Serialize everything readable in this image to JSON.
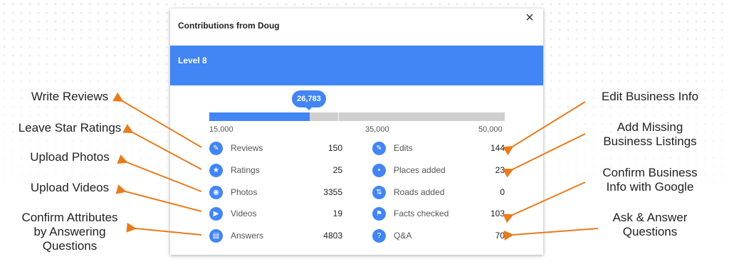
{
  "card": {
    "title": "Contributions from Doug",
    "close_icon": "×",
    "level": "Level 8",
    "points": "26,783",
    "progress_fraction": 0.3391,
    "ticks": [
      "15,000",
      "35,000",
      "50,000"
    ],
    "accent": "#4285f4"
  },
  "stats_left": [
    {
      "label": "Reviews",
      "value": "150",
      "icon": "review-icon",
      "glyph": "✎"
    },
    {
      "label": "Ratings",
      "value": "25",
      "icon": "star-icon",
      "glyph": "★"
    },
    {
      "label": "Photos",
      "value": "3355",
      "icon": "camera-icon",
      "glyph": "◉"
    },
    {
      "label": "Videos",
      "value": "19",
      "icon": "video-icon",
      "glyph": "▶"
    },
    {
      "label": "Answers",
      "value": "4803",
      "icon": "answers-icon",
      "glyph": "▤"
    }
  ],
  "stats_right": [
    {
      "label": "Edits",
      "value": "144",
      "icon": "edit-pin-icon",
      "glyph": "✎"
    },
    {
      "label": "Places added",
      "value": "23",
      "icon": "place-pin-icon",
      "glyph": "•"
    },
    {
      "label": "Roads added",
      "value": "0",
      "icon": "road-icon",
      "glyph": "⇅"
    },
    {
      "label": "Facts checked",
      "value": "103",
      "icon": "flag-icon",
      "glyph": "⚑"
    },
    {
      "label": "Q&A",
      "value": "70",
      "icon": "qa-icon",
      "glyph": "?"
    }
  ],
  "annotations_left": [
    "Write Reviews",
    "Leave Star Ratings",
    "Upload Photos",
    "Upload Videos",
    "Confirm Attributes\nby Answering\nQuestions"
  ],
  "annotations_right": [
    "Edit Business Info",
    "Add Missing\nBusiness Listings",
    "Confirm Business\nInfo with Google",
    "Ask & Answer\nQuestions"
  ],
  "arrow_color": "#e87b1e"
}
